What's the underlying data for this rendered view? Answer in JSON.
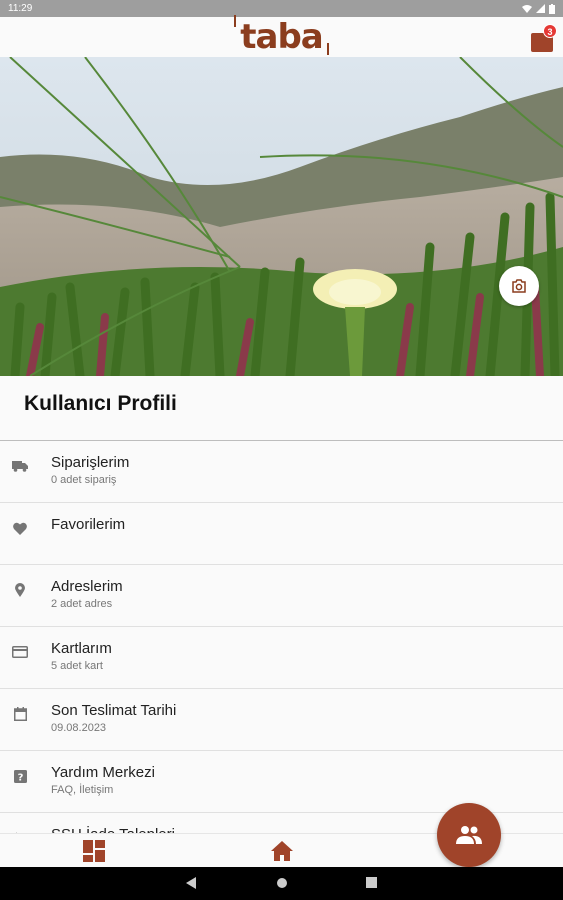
{
  "status_bar": {
    "time": "11:29",
    "icons": [
      "wifi-icon",
      "signal-icon",
      "battery-icon"
    ]
  },
  "app_bar": {
    "logo_text": "taba",
    "cart_count": "3",
    "brand_color": "#a0442a"
  },
  "hero": {
    "camera_icon": "camera-icon"
  },
  "profile": {
    "title": "Kullanıcı Profili"
  },
  "menu": {
    "items": [
      {
        "icon": "truck-icon",
        "title": "Siparişlerim",
        "subtitle": "0 adet sipariş"
      },
      {
        "icon": "heart-icon",
        "title": "Favorilerim",
        "subtitle": ""
      },
      {
        "icon": "location-pin-icon",
        "title": "Adreslerim",
        "subtitle": "2 adet adres"
      },
      {
        "icon": "credit-card-icon",
        "title": "Kartlarım",
        "subtitle": "5 adet kart"
      },
      {
        "icon": "calendar-icon",
        "title": "Son Teslimat Tarihi",
        "subtitle": "09.08.2023"
      },
      {
        "icon": "help-icon",
        "title": "Yardım Merkezi",
        "subtitle": "FAQ, İletişim"
      },
      {
        "icon": "return-icon",
        "title": "SSH İade Talepleri",
        "subtitle": ""
      }
    ]
  },
  "bottom_nav": {
    "items": [
      "dashboard-icon",
      "home-icon"
    ],
    "fab_icon": "people-icon"
  },
  "system_nav": {
    "items": [
      "back-icon",
      "home-circle-icon",
      "recents-icon"
    ]
  }
}
